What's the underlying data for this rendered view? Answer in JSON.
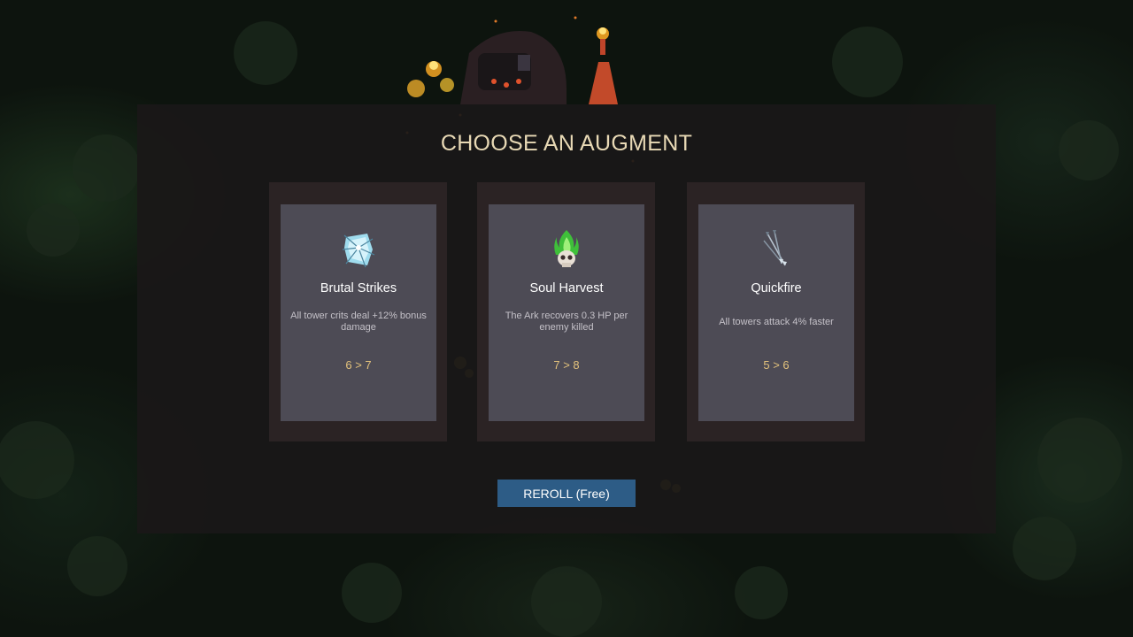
{
  "screen": {
    "title": "CHOOSE AN AUGMENT"
  },
  "augments": [
    {
      "name": "Brutal Strikes",
      "description": "All tower crits deal +12% bonus damage",
      "level": "6 > 7",
      "icon": "shattered-crystal-icon",
      "icon_color": "#8fd8ec"
    },
    {
      "name": "Soul Harvest",
      "description": "The Ark recovers 0.3 HP per enemy killed",
      "level": "7 > 8",
      "icon": "green-flame-skull-icon",
      "icon_color": "#4fd04a"
    },
    {
      "name": "Quickfire",
      "description": "All towers attack 4% faster",
      "level": "5 > 6",
      "icon": "arrows-icon",
      "icon_color": "#a7b6c4"
    }
  ],
  "reroll_button": {
    "label": "REROLL (Free)"
  },
  "colors": {
    "title": "#e8d9b5",
    "card_background": "#4d4b55",
    "card_frame": "#2b2324",
    "level_text": "#e3c27c",
    "button": "#2d5c86"
  }
}
